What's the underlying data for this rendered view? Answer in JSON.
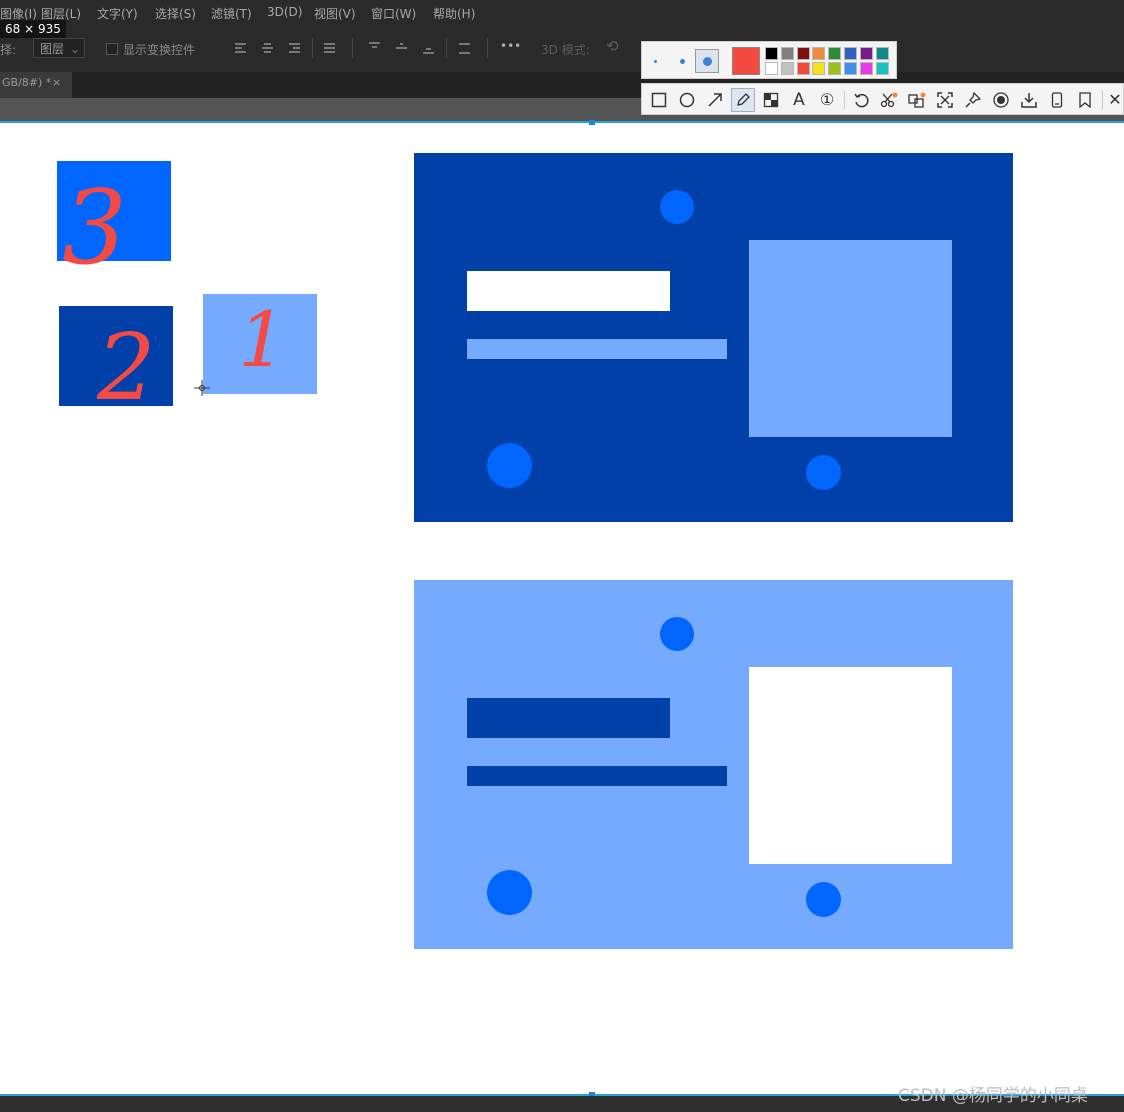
{
  "menu": {
    "items": [
      "图像(I)",
      "图层(L)",
      "文字(Y)",
      "选择(S)",
      "滤镜(T)",
      "3D(D)",
      "视图(V)",
      "窗口(W)",
      "帮助(H)"
    ]
  },
  "dimensions_badge": "68 × 935",
  "options_bar": {
    "select_prefix": "择:",
    "select_value": "图层",
    "show_transform_label": "显示变换控件",
    "more_label": "•••",
    "mode3d_label": "3D 模式:"
  },
  "doc_tab": {
    "title": "GB/8#) *",
    "close": "×"
  },
  "screenshot_tool": {
    "current_color": "#f34a3f",
    "palette_top": [
      "#000000",
      "#808080",
      "#7f1010",
      "#f08a3a",
      "#2e8b3a",
      "#2f5fbf",
      "#7a1a8a",
      "#0f8a8a"
    ],
    "palette_bottom": [
      "#ffffff",
      "#c0c0c0",
      "#f24a3a",
      "#f2e21a",
      "#9ac21a",
      "#3f8ee8",
      "#e83ae8",
      "#18c2c2"
    ],
    "tools": [
      "rectangle-icon",
      "ellipse-icon",
      "arrow-icon",
      "pencil-icon",
      "mosaic-icon",
      "text-icon",
      "number-icon",
      "undo-icon",
      "cut-icon",
      "translate-icon",
      "fullscreen-icon",
      "pin-icon",
      "record-icon",
      "download-icon",
      "phone-icon",
      "bookmark-icon",
      "close-icon"
    ],
    "text_tool_glyph": "A",
    "number_tool_glyph": "①",
    "close_glyph": "✕"
  },
  "canvas": {
    "colors": {
      "bright_blue": "#0066ff",
      "dark_blue": "#0040a8",
      "light_blue": "#76aaff",
      "white": "#ffffff"
    },
    "annotations": [
      "3",
      "2",
      "1"
    ]
  },
  "watermark": "CSDN @杨同学的小同桌"
}
